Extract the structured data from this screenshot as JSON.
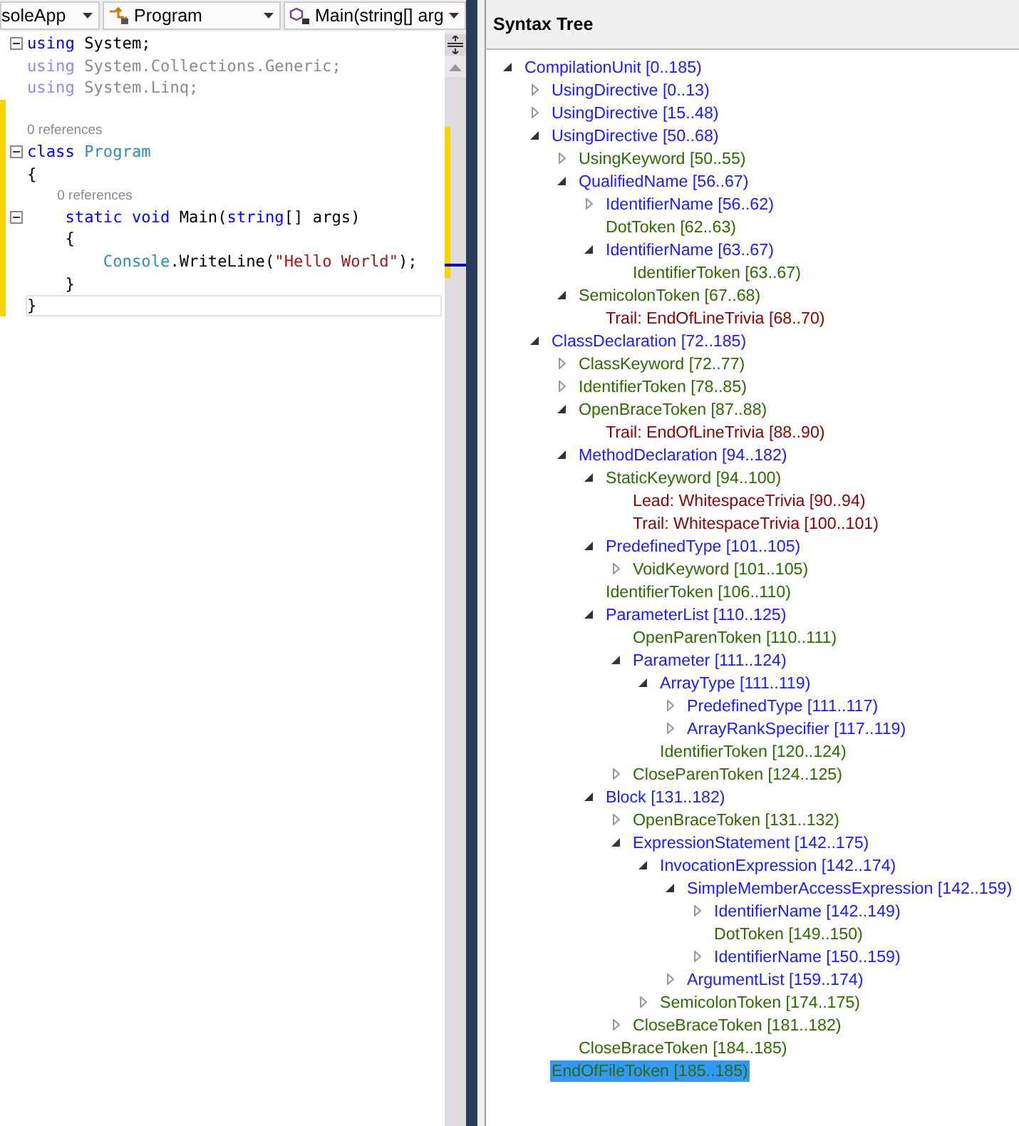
{
  "toolbar": {
    "dropdowns": [
      {
        "kind": "project",
        "label": "soleApp"
      },
      {
        "kind": "class",
        "label": "Program"
      },
      {
        "kind": "member",
        "label": "Main(string[] arg"
      }
    ]
  },
  "editor": {
    "lines": [
      {
        "kind": "code",
        "fold_toggle": true,
        "changed": false,
        "current": false,
        "tokens": [
          {
            "kind": "keyword",
            "text": "using"
          },
          {
            "kind": "plain",
            "text": " System;"
          }
        ]
      },
      {
        "kind": "code",
        "fold_toggle": false,
        "changed": false,
        "current": false,
        "tokens": [
          {
            "kind": "faded_keyword",
            "text": "using"
          },
          {
            "kind": "faded",
            "text": " System.Collections.Generic;"
          }
        ]
      },
      {
        "kind": "code",
        "fold_toggle": false,
        "changed": false,
        "current": false,
        "tokens": [
          {
            "kind": "faded_keyword",
            "text": "using"
          },
          {
            "kind": "faded",
            "text": " System.Linq;"
          }
        ]
      },
      {
        "kind": "blank",
        "fold_toggle": false,
        "changed": true,
        "current": false
      },
      {
        "kind": "codelens",
        "fold_toggle": false,
        "changed": true,
        "current": false,
        "text": "0 references"
      },
      {
        "kind": "code",
        "fold_toggle": true,
        "changed": true,
        "current": false,
        "tokens": [
          {
            "kind": "keyword",
            "text": "class "
          },
          {
            "kind": "type",
            "text": "Program"
          }
        ]
      },
      {
        "kind": "code",
        "fold_toggle": false,
        "changed": true,
        "current": false,
        "tokens": [
          {
            "kind": "plain",
            "text": "{"
          }
        ]
      },
      {
        "kind": "codelens",
        "fold_toggle": false,
        "changed": true,
        "current": false,
        "text": "    0 references"
      },
      {
        "kind": "code",
        "fold_toggle": true,
        "changed": true,
        "current": false,
        "tokens": [
          {
            "kind": "keyword",
            "text": "    static "
          },
          {
            "kind": "keyword",
            "text": "void"
          },
          {
            "kind": "plain",
            "text": " Main("
          },
          {
            "kind": "keyword",
            "text": "string"
          },
          {
            "kind": "plain",
            "text": "[] args)"
          }
        ]
      },
      {
        "kind": "code",
        "fold_toggle": false,
        "changed": true,
        "current": false,
        "tokens": [
          {
            "kind": "plain",
            "text": "    {"
          }
        ]
      },
      {
        "kind": "code",
        "fold_toggle": false,
        "changed": true,
        "current": false,
        "tokens": [
          {
            "kind": "type",
            "text": "        Console"
          },
          {
            "kind": "plain",
            "text": ".WriteLine("
          },
          {
            "kind": "string",
            "text": "\"Hello World\""
          },
          {
            "kind": "plain",
            "text": ");"
          }
        ]
      },
      {
        "kind": "code",
        "fold_toggle": false,
        "changed": true,
        "current": false,
        "tokens": [
          {
            "kind": "plain",
            "text": "    }"
          }
        ]
      },
      {
        "kind": "code",
        "fold_toggle": false,
        "changed": true,
        "current": true,
        "tokens": [
          {
            "kind": "plain",
            "text": "}"
          }
        ]
      }
    ]
  },
  "syntax_tree": {
    "title": "Syntax Tree",
    "nodes": [
      {
        "label": "CompilationUnit [0..185)",
        "kind": "node",
        "expanded": true,
        "selected": false,
        "children": [
          {
            "label": "UsingDirective [0..13)",
            "kind": "node",
            "expanded": false,
            "selected": false
          },
          {
            "label": "UsingDirective [15..48)",
            "kind": "node",
            "expanded": false,
            "selected": false
          },
          {
            "label": "UsingDirective [50..68)",
            "kind": "node",
            "expanded": true,
            "selected": false,
            "children": [
              {
                "label": "UsingKeyword [50..55)",
                "kind": "token",
                "expanded": false,
                "selected": false
              },
              {
                "label": "QualifiedName [56..67)",
                "kind": "node",
                "expanded": true,
                "selected": false,
                "children": [
                  {
                    "label": "IdentifierName [56..62)",
                    "kind": "node",
                    "expanded": false,
                    "selected": false
                  },
                  {
                    "label": "DotToken [62..63)",
                    "kind": "token",
                    "selected": false
                  },
                  {
                    "label": "IdentifierName [63..67)",
                    "kind": "node",
                    "expanded": true,
                    "selected": false,
                    "children": [
                      {
                        "label": "IdentifierToken [63..67)",
                        "kind": "token",
                        "selected": false
                      }
                    ]
                  }
                ]
              },
              {
                "label": "SemicolonToken [67..68)",
                "kind": "token",
                "expanded": true,
                "selected": false,
                "children": [
                  {
                    "label": "Trail: EndOfLineTrivia [68..70)",
                    "kind": "trivia",
                    "selected": false
                  }
                ]
              }
            ]
          },
          {
            "label": "ClassDeclaration [72..185)",
            "kind": "node",
            "expanded": true,
            "selected": false,
            "children": [
              {
                "label": "ClassKeyword [72..77)",
                "kind": "token",
                "expanded": false,
                "selected": false
              },
              {
                "label": "IdentifierToken [78..85)",
                "kind": "token",
                "expanded": false,
                "selected": false
              },
              {
                "label": "OpenBraceToken [87..88)",
                "kind": "token",
                "expanded": true,
                "selected": false,
                "children": [
                  {
                    "label": "Trail: EndOfLineTrivia [88..90)",
                    "kind": "trivia",
                    "selected": false
                  }
                ]
              },
              {
                "label": "MethodDeclaration [94..182)",
                "kind": "node",
                "expanded": true,
                "selected": false,
                "children": [
                  {
                    "label": "StaticKeyword [94..100)",
                    "kind": "token",
                    "expanded": true,
                    "selected": false,
                    "children": [
                      {
                        "label": "Lead: WhitespaceTrivia [90..94)",
                        "kind": "trivia",
                        "selected": false
                      },
                      {
                        "label": "Trail: WhitespaceTrivia [100..101)",
                        "kind": "trivia",
                        "selected": false
                      }
                    ]
                  },
                  {
                    "label": "PredefinedType [101..105)",
                    "kind": "node",
                    "expanded": true,
                    "selected": false,
                    "children": [
                      {
                        "label": "VoidKeyword [101..105)",
                        "kind": "token",
                        "expanded": false,
                        "selected": false
                      }
                    ]
                  },
                  {
                    "label": "IdentifierToken [106..110)",
                    "kind": "token",
                    "selected": false
                  },
                  {
                    "label": "ParameterList [110..125)",
                    "kind": "node",
                    "expanded": true,
                    "selected": false,
                    "children": [
                      {
                        "label": "OpenParenToken [110..111)",
                        "kind": "token",
                        "selected": false
                      },
                      {
                        "label": "Parameter [111..124)",
                        "kind": "node",
                        "expanded": true,
                        "selected": false,
                        "children": [
                          {
                            "label": "ArrayType [111..119)",
                            "kind": "node",
                            "expanded": true,
                            "selected": false,
                            "children": [
                              {
                                "label": "PredefinedType [111..117)",
                                "kind": "node",
                                "expanded": false,
                                "selected": false
                              },
                              {
                                "label": "ArrayRankSpecifier [117..119)",
                                "kind": "node",
                                "expanded": false,
                                "selected": false
                              }
                            ]
                          },
                          {
                            "label": "IdentifierToken [120..124)",
                            "kind": "token",
                            "selected": false
                          }
                        ]
                      },
                      {
                        "label": "CloseParenToken [124..125)",
                        "kind": "token",
                        "expanded": false,
                        "selected": false
                      }
                    ]
                  },
                  {
                    "label": "Block [131..182)",
                    "kind": "node",
                    "expanded": true,
                    "selected": false,
                    "children": [
                      {
                        "label": "OpenBraceToken [131..132)",
                        "kind": "token",
                        "expanded": false,
                        "selected": false
                      },
                      {
                        "label": "ExpressionStatement [142..175)",
                        "kind": "node",
                        "expanded": true,
                        "selected": false,
                        "children": [
                          {
                            "label": "InvocationExpression [142..174)",
                            "kind": "node",
                            "expanded": true,
                            "selected": false,
                            "children": [
                              {
                                "label": "SimpleMemberAccessExpression [142..159)",
                                "kind": "node",
                                "expanded": true,
                                "selected": false,
                                "children": [
                                  {
                                    "label": "IdentifierName [142..149)",
                                    "kind": "node",
                                    "expanded": false,
                                    "selected": false
                                  },
                                  {
                                    "label": "DotToken [149..150)",
                                    "kind": "token",
                                    "selected": false
                                  },
                                  {
                                    "label": "IdentifierName [150..159)",
                                    "kind": "node",
                                    "expanded": false,
                                    "selected": false
                                  }
                                ]
                              },
                              {
                                "label": "ArgumentList [159..174)",
                                "kind": "node",
                                "expanded": false,
                                "selected": false
                              }
                            ]
                          },
                          {
                            "label": "SemicolonToken [174..175)",
                            "kind": "token",
                            "expanded": false,
                            "selected": false
                          }
                        ]
                      },
                      {
                        "label": "CloseBraceToken [181..182)",
                        "kind": "token",
                        "expanded": false,
                        "selected": false
                      }
                    ]
                  }
                ]
              },
              {
                "label": "CloseBraceToken [184..185)",
                "kind": "token",
                "selected": false
              }
            ]
          },
          {
            "label": "EndOfFileToken [185..185)",
            "kind": "token",
            "selected": true
          }
        ]
      }
    ]
  }
}
